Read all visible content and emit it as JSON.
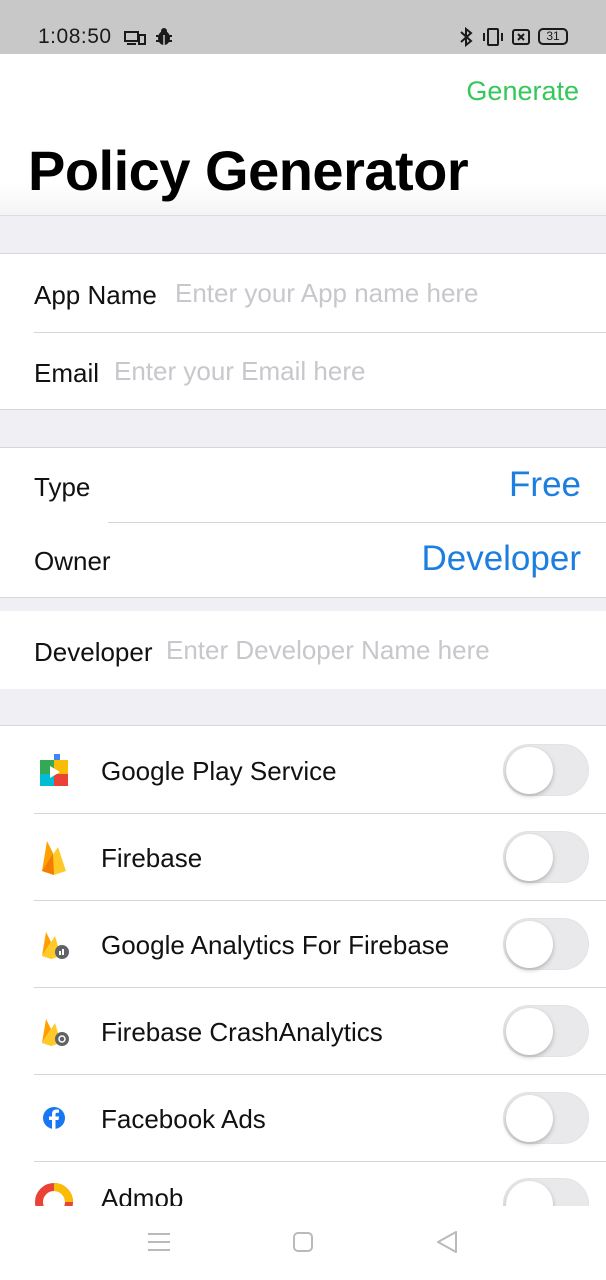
{
  "status_bar": {
    "time": "1:08:50",
    "battery": "31",
    "icons": [
      "cast-icon",
      "bug-icon",
      "bluetooth-icon",
      "vibrate-icon",
      "sim-icon",
      "battery-icon"
    ]
  },
  "header": {
    "generate_label": "Generate",
    "title": "Policy Generator",
    "accent_color": "#34c759"
  },
  "form": {
    "app_name": {
      "label": "App Name",
      "value": "",
      "placeholder": "Enter your App name here"
    },
    "email": {
      "label": "Email",
      "value": "",
      "placeholder": "Enter your Email here"
    },
    "type": {
      "label": "Type",
      "value": "Free"
    },
    "owner": {
      "label": "Owner",
      "value": "Developer"
    },
    "developer": {
      "label": "Developer",
      "value": "",
      "placeholder": "Enter Developer Name here"
    },
    "value_color": "#1c7fe0"
  },
  "services": [
    {
      "name": "Google Play Service",
      "icon": "google-play-services-icon",
      "enabled": false
    },
    {
      "name": "Firebase",
      "icon": "firebase-icon",
      "enabled": false
    },
    {
      "name": "Google Analytics For Firebase",
      "icon": "firebase-analytics-icon",
      "enabled": false
    },
    {
      "name": "Firebase CrashAnalytics",
      "icon": "firebase-crashlytics-icon",
      "enabled": false
    },
    {
      "name": "Facebook Ads",
      "icon": "facebook-icon",
      "enabled": false
    },
    {
      "name": "Admob",
      "icon": "admob-icon",
      "enabled": false
    }
  ],
  "nav_bar": {
    "icons": [
      "menu-icon",
      "home-icon",
      "back-icon"
    ]
  }
}
